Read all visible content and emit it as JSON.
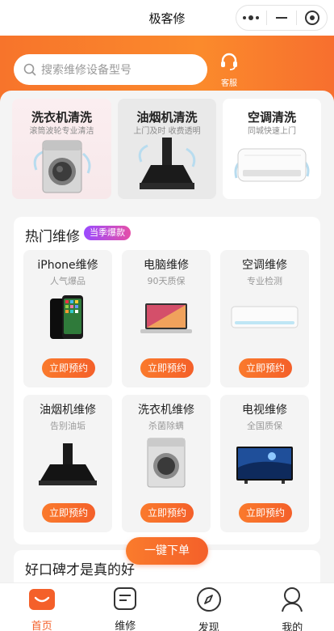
{
  "topbar": {
    "title": "极客修",
    "more_icon": "more-dots-icon",
    "minimize_icon": "minimize-icon",
    "close_icon": "target-close-icon"
  },
  "header": {
    "search_placeholder": "搜索维修设备型号",
    "service_label": "客服",
    "brand_color": "#f7742b"
  },
  "promos": [
    {
      "title": "洗衣机清洗",
      "subtitle": "滚筒波轮专业清洁",
      "image": "washing-machine"
    },
    {
      "title": "油烟机清洗",
      "subtitle": "上门及时 收费透明",
      "image": "range-hood"
    },
    {
      "title": "空调清洗",
      "subtitle": "同城快速上门",
      "image": "air-conditioner"
    }
  ],
  "hot": {
    "title": "热门维修",
    "badge": "当季爆款",
    "button_label": "立即预约",
    "items": [
      {
        "title": "iPhone维修",
        "subtitle": "人气爆品",
        "image": "iphone"
      },
      {
        "title": "电脑维修",
        "subtitle": "90天质保",
        "image": "laptop"
      },
      {
        "title": "空调维修",
        "subtitle": "专业检测",
        "image": "air-conditioner"
      },
      {
        "title": "油烟机维修",
        "subtitle": "告别油垢",
        "image": "range-hood"
      },
      {
        "title": "洗衣机维修",
        "subtitle": "杀菌除螨",
        "image": "washing-machine"
      },
      {
        "title": "电视维修",
        "subtitle": "全国质保",
        "image": "tv"
      }
    ]
  },
  "float_button": "一键下单",
  "reviews": {
    "title": "好口碑才是真的好"
  },
  "nav": [
    {
      "label": "首页",
      "icon": "home-icon",
      "active": true
    },
    {
      "label": "维修",
      "icon": "repair-list-icon",
      "active": false
    },
    {
      "label": "发现",
      "icon": "compass-icon",
      "active": false
    },
    {
      "label": "我的",
      "icon": "profile-icon",
      "active": false
    }
  ]
}
